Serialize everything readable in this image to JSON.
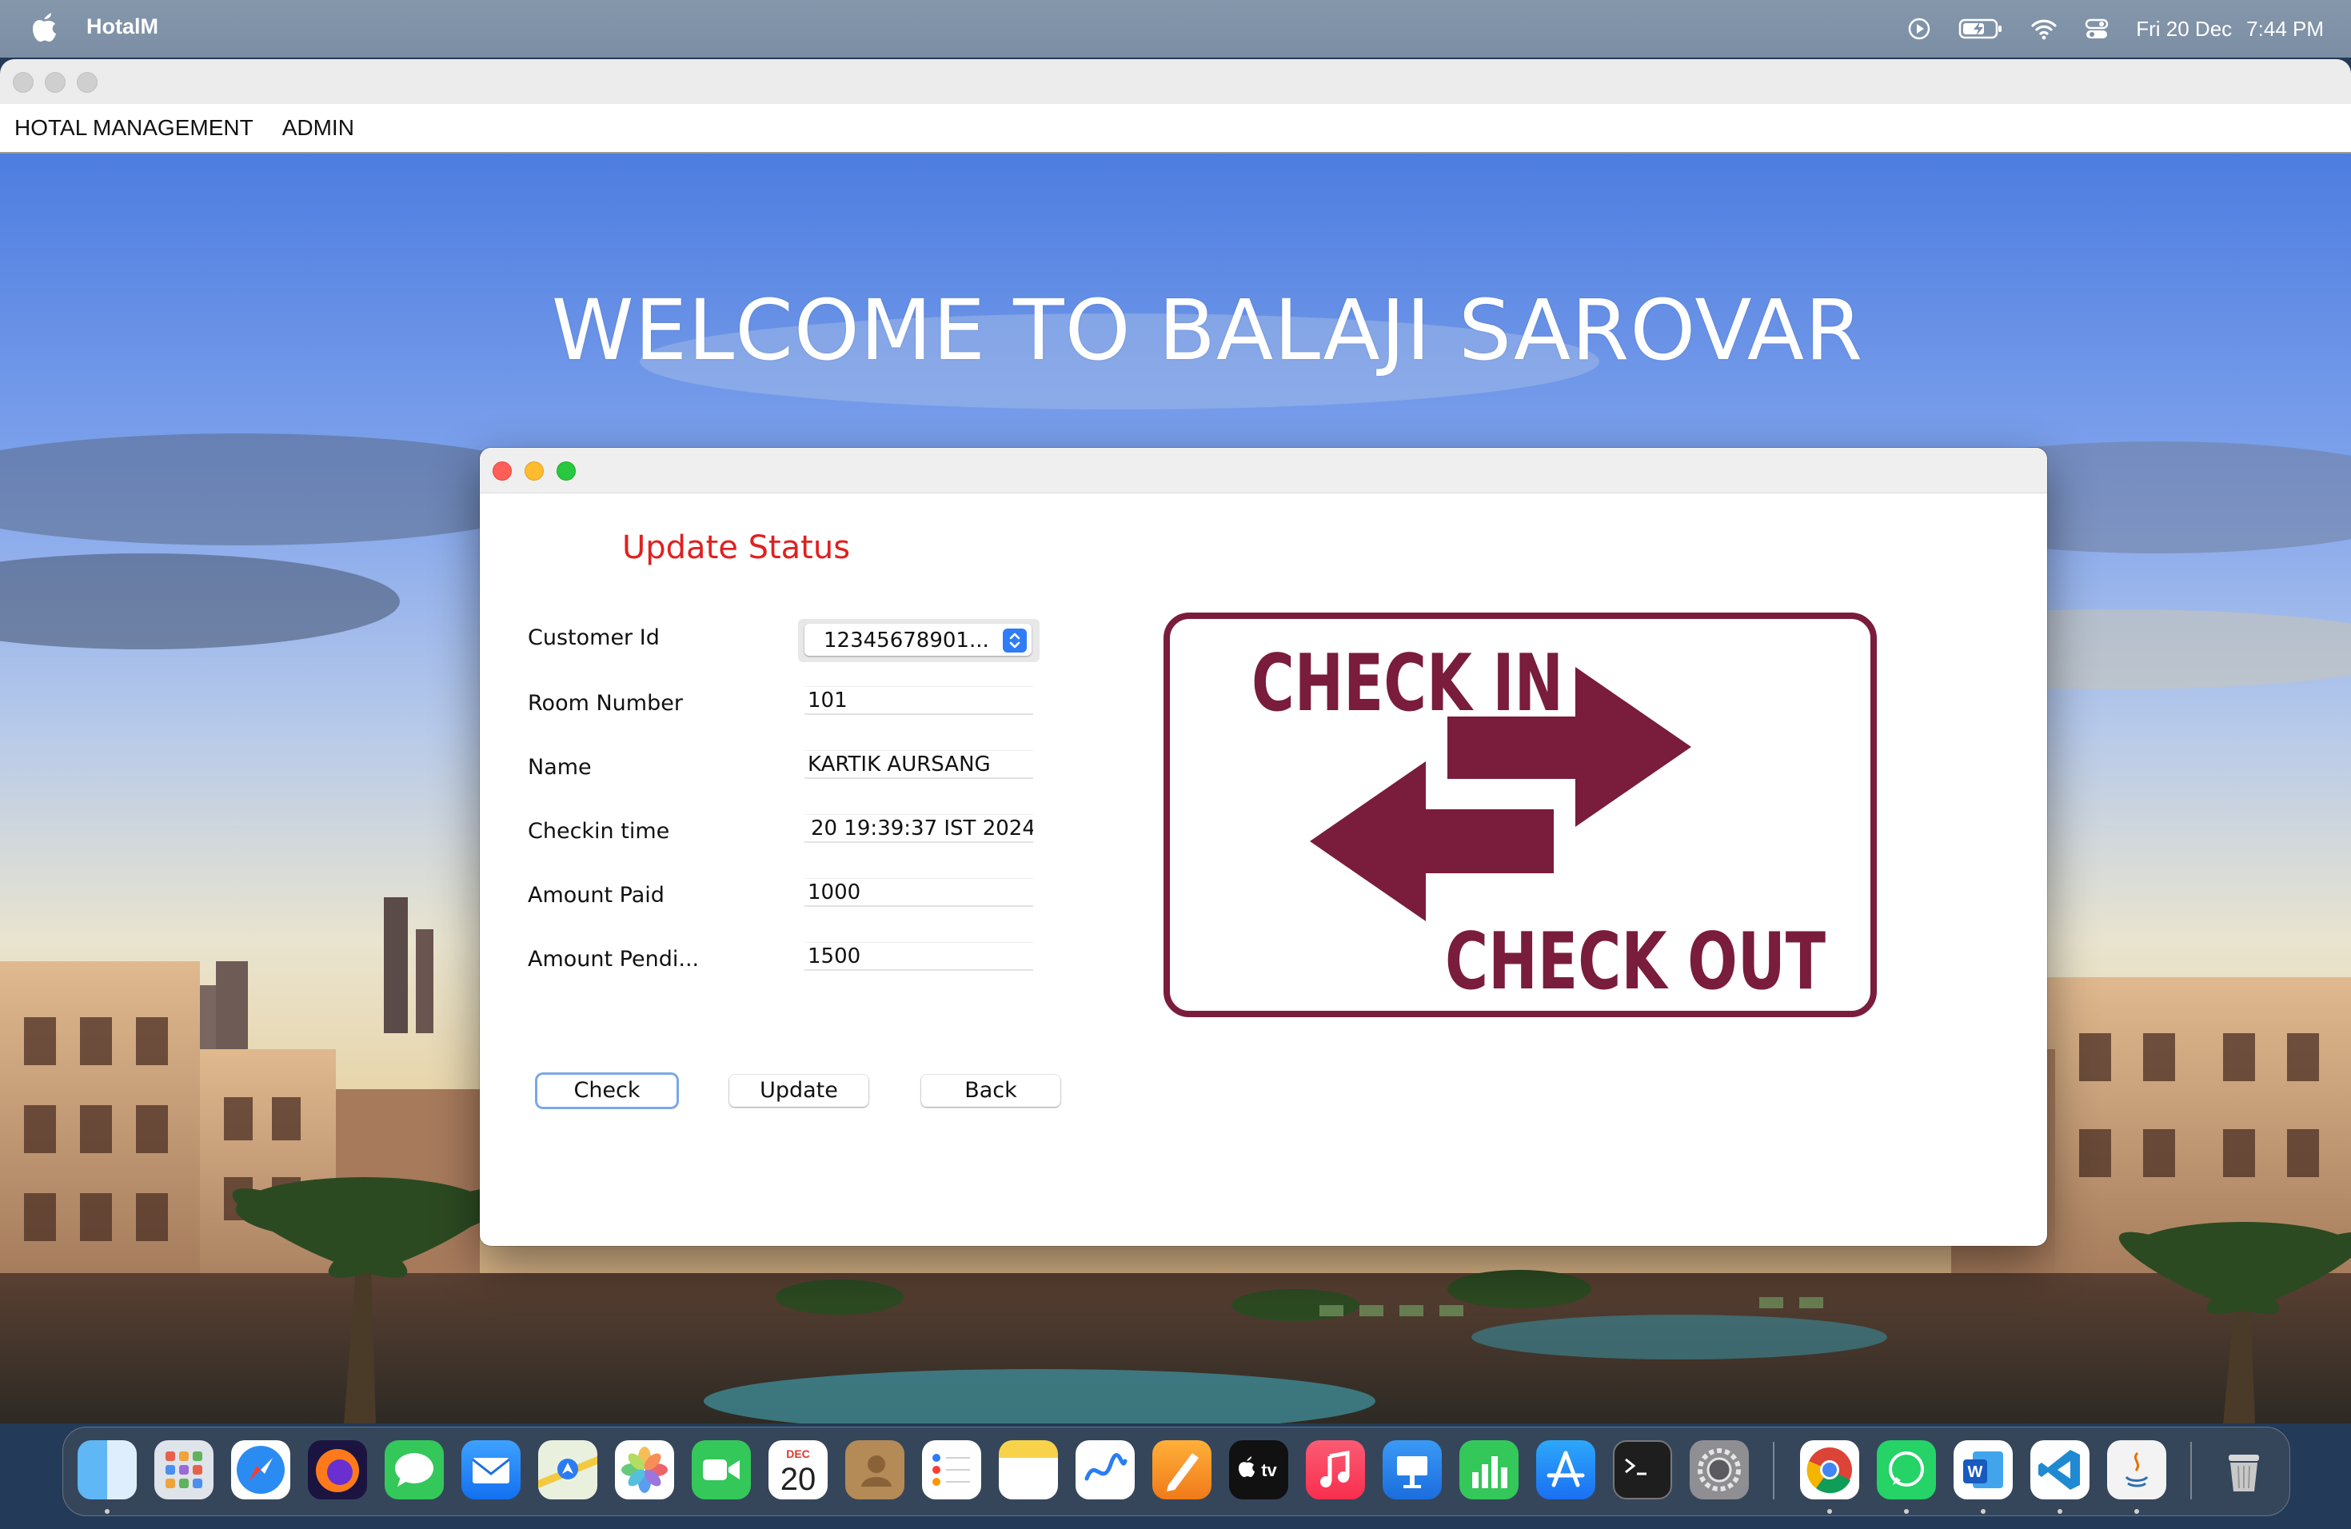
{
  "menubar": {
    "app_name": "HotalM",
    "date": "Fri 20 Dec",
    "time": "7:44 PM"
  },
  "window": {
    "menu": [
      "HOTAL MANAGEMENT",
      "ADMIN"
    ],
    "welcome": "WELCOME TO BALAJI SAROVAR"
  },
  "dialog": {
    "heading": "Update Status",
    "labels": {
      "customer_id": "Customer Id",
      "room_number": "Room Number",
      "name": "Name",
      "checkin_time": "Checkin time",
      "amount_paid": "Amount Paid",
      "amount_pending": "Amount Pendi..."
    },
    "values": {
      "customer_id": "12345678901...",
      "room_number": "101",
      "name": "KARTIK AURSANG",
      "checkin_time": "20 19:39:37 IST 2024",
      "amount_paid": "1000",
      "amount_pending": "1500"
    },
    "buttons": {
      "check": "Check",
      "update": "Update",
      "back": "Back"
    },
    "image_text": {
      "check_in": "CHECK IN",
      "check_out": "CHECK OUT"
    }
  },
  "dock": {
    "apps": [
      "finder-icon",
      "launchpad-icon",
      "safari-icon",
      "firefox-icon",
      "messages-icon",
      "mail-icon",
      "maps-icon",
      "photos-icon",
      "facetime-icon",
      "calendar-icon",
      "contacts-icon",
      "reminders-icon",
      "notes-icon",
      "freeform-icon",
      "pages-icon",
      "apple-tv-icon",
      "music-icon",
      "keynote-icon",
      "numbers-icon",
      "app-store-icon",
      "terminal-icon",
      "system-settings-icon",
      "chrome-icon",
      "whatsapp-icon",
      "word-icon",
      "vscode-icon",
      "java-icon",
      "trash-icon"
    ],
    "calendar_month": "DEC",
    "calendar_day": "20",
    "tv_label": "tv"
  }
}
